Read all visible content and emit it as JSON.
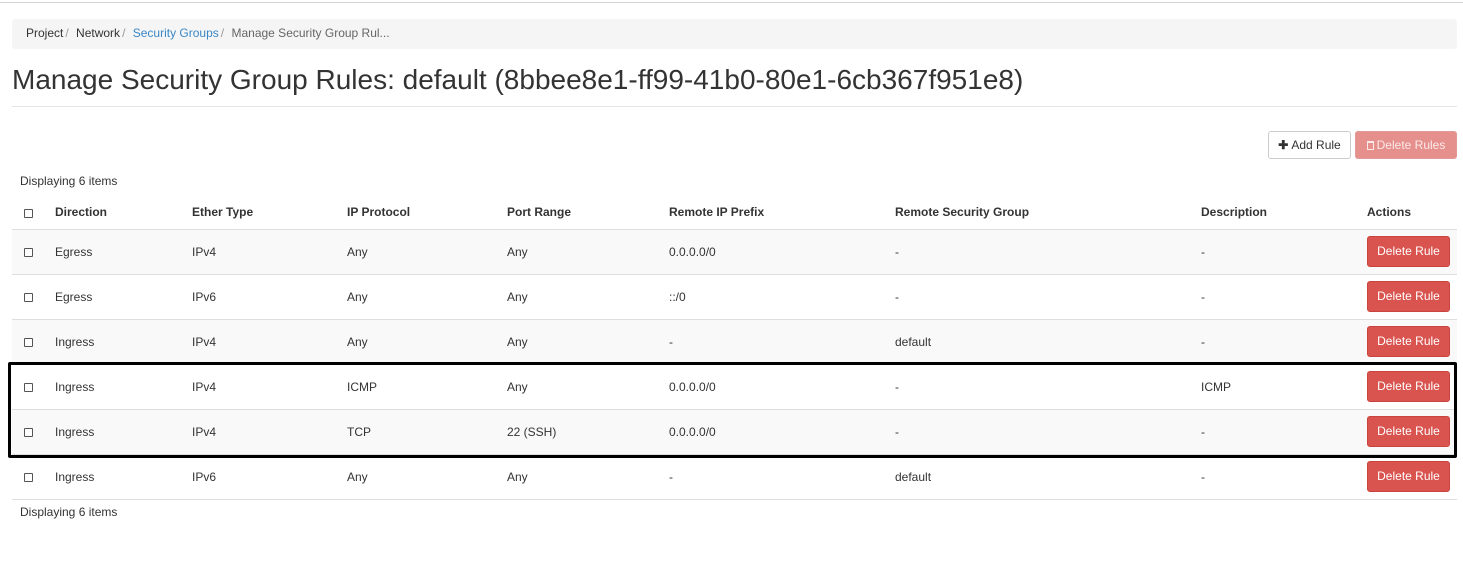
{
  "breadcrumb": {
    "items": [
      "Project",
      "Network",
      "Security Groups",
      "Manage Security Group Rul..."
    ]
  },
  "page": {
    "title": "Manage Security Group Rules: default (8bbee8e1-ff99-41b0-80e1-6cb367f951e8)"
  },
  "toolbar": {
    "add_rule": "Add Rule",
    "delete_rules": "Delete Rules"
  },
  "table": {
    "count_top": "Displaying 6 items",
    "count_bottom": "Displaying 6 items",
    "columns": [
      "Direction",
      "Ether Type",
      "IP Protocol",
      "Port Range",
      "Remote IP Prefix",
      "Remote Security Group",
      "Description",
      "Actions"
    ],
    "rows": [
      {
        "direction": "Egress",
        "ether_type": "IPv4",
        "ip_protocol": "Any",
        "port_range": "Any",
        "remote_ip_prefix": "0.0.0.0/0",
        "remote_security_group": "-",
        "description": "-",
        "action": "Delete Rule"
      },
      {
        "direction": "Egress",
        "ether_type": "IPv6",
        "ip_protocol": "Any",
        "port_range": "Any",
        "remote_ip_prefix": "::/0",
        "remote_security_group": "-",
        "description": "-",
        "action": "Delete Rule"
      },
      {
        "direction": "Ingress",
        "ether_type": "IPv4",
        "ip_protocol": "Any",
        "port_range": "Any",
        "remote_ip_prefix": "-",
        "remote_security_group": "default",
        "description": "-",
        "action": "Delete Rule"
      },
      {
        "direction": "Ingress",
        "ether_type": "IPv4",
        "ip_protocol": "ICMP",
        "port_range": "Any",
        "remote_ip_prefix": "0.0.0.0/0",
        "remote_security_group": "-",
        "description": "ICMP",
        "action": "Delete Rule"
      },
      {
        "direction": "Ingress",
        "ether_type": "IPv4",
        "ip_protocol": "TCP",
        "port_range": "22 (SSH)",
        "remote_ip_prefix": "0.0.0.0/0",
        "remote_security_group": "-",
        "description": "-",
        "action": "Delete Rule"
      },
      {
        "direction": "Ingress",
        "ether_type": "IPv6",
        "ip_protocol": "Any",
        "port_range": "Any",
        "remote_ip_prefix": "-",
        "remote_security_group": "default",
        "description": "-",
        "action": "Delete Rule"
      }
    ]
  },
  "colors": {
    "link": "#3a87c8",
    "danger": "#d9534f",
    "danger_disabled": "#e5908d",
    "row_stripe": "#f9f9f9"
  }
}
